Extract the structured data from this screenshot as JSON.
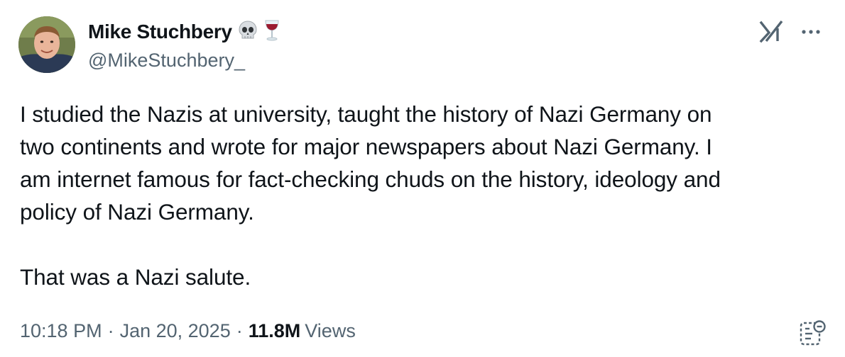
{
  "author": {
    "display_name": "Mike Stuchbery",
    "handle": "@MikeStuchbery_",
    "name_emojis": [
      "skull-emoji",
      "wine-glass-emoji"
    ]
  },
  "tweet": {
    "text": "I studied the Nazis at university, taught the history of Nazi Germany on\ntwo continents and wrote for major newspapers about Nazi Germany. I\nam internet famous for fact-checking chuds on the history, ideology and\npolicy of Nazi Germany.\n\nThat was a Nazi salute."
  },
  "meta": {
    "time": "10:18 PM",
    "separator": "·",
    "date": "Jan 20, 2025",
    "views_count": "11.8M",
    "views_label": "Views"
  },
  "icons": {
    "grok": "grok-icon",
    "more": "more-icon",
    "notes": "community-notes-icon"
  },
  "colors": {
    "text_primary": "#0f1419",
    "text_secondary": "#536471",
    "background": "#ffffff"
  }
}
